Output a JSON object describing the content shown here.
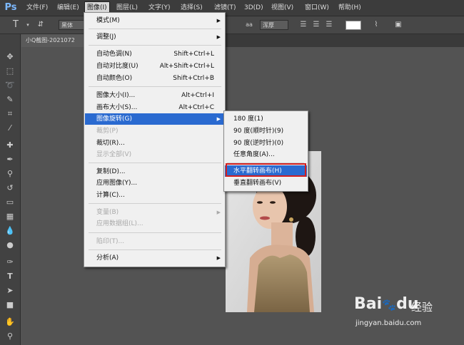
{
  "app": {
    "logo": "Ps"
  },
  "menubar": [
    {
      "label": "文件(F)"
    },
    {
      "label": "编辑(E)"
    },
    {
      "label": "图像(I)"
    },
    {
      "label": "图层(L)"
    },
    {
      "label": "文字(Y)"
    },
    {
      "label": "选择(S)"
    },
    {
      "label": "滤镜(T)"
    },
    {
      "label": "3D(D)"
    },
    {
      "label": "视图(V)"
    },
    {
      "label": "窗口(W)"
    },
    {
      "label": "帮助(H)"
    }
  ],
  "options_bar": {
    "tool_glyph": "T",
    "font_family": "黑体",
    "size_icon": "aa",
    "antialias": "浑厚",
    "text_color": "#ffffff"
  },
  "document_tab": {
    "title": "小Q截图-2021072"
  },
  "image_menu": {
    "items": [
      {
        "label": "模式(M)",
        "shortcut": "",
        "submenu": true,
        "disabled": false
      },
      {
        "label": "调整(J)",
        "shortcut": "",
        "submenu": true,
        "disabled": false
      },
      {
        "label": "自动色调(N)",
        "shortcut": "Shift+Ctrl+L",
        "submenu": false,
        "disabled": false
      },
      {
        "label": "自动对比度(U)",
        "shortcut": "Alt+Shift+Ctrl+L",
        "submenu": false,
        "disabled": false
      },
      {
        "label": "自动颜色(O)",
        "shortcut": "Shift+Ctrl+B",
        "submenu": false,
        "disabled": false
      },
      {
        "label": "图像大小(I)...",
        "shortcut": "Alt+Ctrl+I",
        "submenu": false,
        "disabled": false
      },
      {
        "label": "画布大小(S)...",
        "shortcut": "Alt+Ctrl+C",
        "submenu": false,
        "disabled": false
      },
      {
        "label": "图像旋转(G)",
        "shortcut": "",
        "submenu": true,
        "disabled": false,
        "highlighted": true
      },
      {
        "label": "裁剪(P)",
        "shortcut": "",
        "submenu": false,
        "disabled": true
      },
      {
        "label": "裁切(R)...",
        "shortcut": "",
        "submenu": false,
        "disabled": false
      },
      {
        "label": "显示全部(V)",
        "shortcut": "",
        "submenu": false,
        "disabled": true
      },
      {
        "label": "复制(D)...",
        "shortcut": "",
        "submenu": false,
        "disabled": false
      },
      {
        "label": "应用图像(Y)...",
        "shortcut": "",
        "submenu": false,
        "disabled": false
      },
      {
        "label": "计算(C)...",
        "shortcut": "",
        "submenu": false,
        "disabled": false
      },
      {
        "label": "变量(B)",
        "shortcut": "",
        "submenu": true,
        "disabled": true
      },
      {
        "label": "应用数据组(L)...",
        "shortcut": "",
        "submenu": false,
        "disabled": true
      },
      {
        "label": "陷印(T)...",
        "shortcut": "",
        "submenu": false,
        "disabled": true
      },
      {
        "label": "分析(A)",
        "shortcut": "",
        "submenu": true,
        "disabled": false
      }
    ]
  },
  "rotate_submenu": {
    "items": [
      {
        "label": "180 度(1)"
      },
      {
        "label": "90 度(顺时针)(9)"
      },
      {
        "label": "90 度(逆时针)(0)"
      },
      {
        "label": "任意角度(A)..."
      },
      {
        "label": "水平翻转画布(H)",
        "highlighted": true
      },
      {
        "label": "垂直翻转画布(V)"
      }
    ]
  },
  "watermark": {
    "logo": "Bai",
    "logo_tail": "du",
    "brand_cn": "经验",
    "url": "jingyan.baidu.com"
  },
  "colors": {
    "highlight": "#2a6ad0",
    "callout": "#d21f1f"
  }
}
